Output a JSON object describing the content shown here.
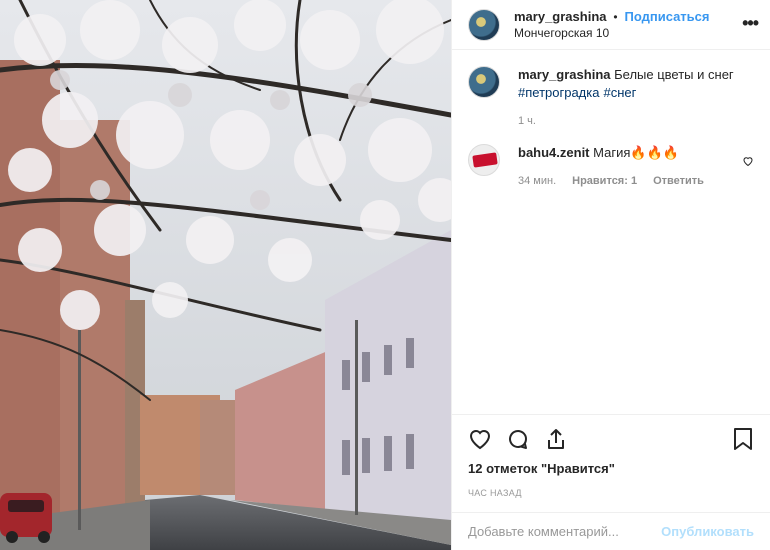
{
  "post": {
    "username": "mary_grashina",
    "separator": "•",
    "follow_label": "Подписаться",
    "location": "Мончегорская 10",
    "more_label": "•••"
  },
  "caption": {
    "username": "mary_grashina",
    "text": "Белые цветы и снег",
    "tags": [
      "#петроградка",
      "#снег"
    ],
    "time": "1 ч."
  },
  "comment": {
    "username": "bahu4.zenit",
    "text": "Магия",
    "emoji": "🔥🔥🔥",
    "time": "34 мин.",
    "likes": "Нравится: 1",
    "reply": "Ответить"
  },
  "actions": {
    "likes_text": "12 отметок \"Нравится\"",
    "posted_ago": "ЧАС НАЗАД"
  },
  "add_comment": {
    "placeholder": "Добавьте комментарий...",
    "publish": "Опубликовать"
  },
  "icons": {
    "like": "heart-icon",
    "comment": "comment-icon",
    "share": "share-icon",
    "save": "bookmark-icon",
    "options": "more-icon"
  },
  "colors": {
    "accent": "#3897f0",
    "publish_disabled": "#b2dffc",
    "hashtag": "#003569"
  }
}
